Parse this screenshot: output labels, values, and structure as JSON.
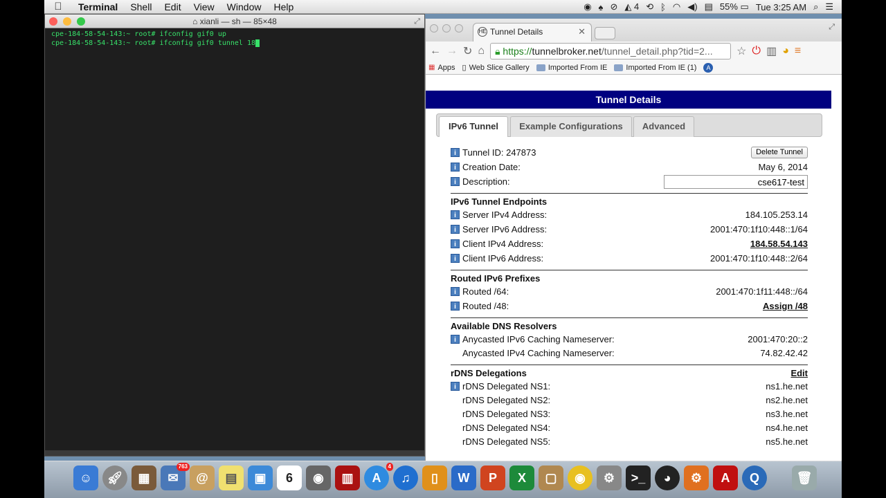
{
  "menubar": {
    "app": "Terminal",
    "items": [
      "Shell",
      "Edit",
      "View",
      "Window",
      "Help"
    ],
    "status": {
      "badge_count": "4",
      "battery": "55%",
      "clock": "Tue 3:25 AM"
    }
  },
  "terminal": {
    "title": "xianli — sh — 85×48",
    "lines": [
      "cpe-184-58-54-143:~ root# ifconfig gif0 up",
      "cpe-184-58-54-143:~ root# ifconfig gif0 tunnel 18"
    ]
  },
  "browser": {
    "tab_title": "Tunnel Details",
    "url_https": "https://",
    "url_host": "tunnelbroker.net",
    "url_rest": "/tunnel_detail.php?tid=2...",
    "bookmarks": [
      "Apps",
      "Web Slice Gallery",
      "Imported From IE",
      "Imported From IE (1)"
    ]
  },
  "page": {
    "title": "Tunnel Details",
    "tabs": [
      "IPv6 Tunnel",
      "Example Configurations",
      "Advanced"
    ],
    "tunnel_id_label": "Tunnel ID: 247873",
    "delete_button": "Delete Tunnel",
    "creation_label": "Creation Date:",
    "creation_value": "May 6, 2014",
    "description_label": "Description:",
    "description_value": "cse617-test",
    "endpoints_header": "IPv6 Tunnel Endpoints",
    "server_ipv4_label": "Server IPv4 Address:",
    "server_ipv4_value": "184.105.253.14",
    "server_ipv6_label": "Server IPv6 Address:",
    "server_ipv6_value": "2001:470:1f10:448::1/64",
    "client_ipv4_label": "Client IPv4 Address:",
    "client_ipv4_value": "184.58.54.143",
    "client_ipv6_label": "Client IPv6 Address:",
    "client_ipv6_value": "2001:470:1f10:448::2/64",
    "routed_header": "Routed IPv6 Prefixes",
    "routed64_label": "Routed /64:",
    "routed64_value": "2001:470:1f11:448::/64",
    "routed48_label": "Routed /48:",
    "routed48_value": "Assign /48",
    "dns_header": "Available DNS Resolvers",
    "dns6_label": "Anycasted IPv6 Caching Nameserver:",
    "dns6_value": "2001:470:20::2",
    "dns4_label": "Anycasted IPv4 Caching Nameserver:",
    "dns4_value": "74.82.42.42",
    "rdns_header": "rDNS Delegations",
    "rdns_edit": "Edit",
    "rdns": [
      {
        "label": "rDNS Delegated NS1:",
        "value": "ns1.he.net"
      },
      {
        "label": "rDNS Delegated NS2:",
        "value": "ns2.he.net"
      },
      {
        "label": "rDNS Delegated NS3:",
        "value": "ns3.he.net"
      },
      {
        "label": "rDNS Delegated NS4:",
        "value": "ns4.he.net"
      },
      {
        "label": "rDNS Delegated NS5:",
        "value": "ns5.he.net"
      }
    ]
  },
  "dock": {
    "mail_badge": "763",
    "calendar_day": "6",
    "appstore_badge": "4"
  }
}
